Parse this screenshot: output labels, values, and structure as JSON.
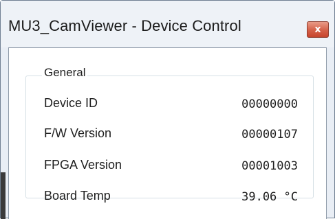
{
  "window": {
    "title": "MU3_CamViewer - Device Control",
    "close_glyph": "x"
  },
  "general": {
    "title": "General",
    "rows": [
      {
        "label": "Device ID",
        "value": "00000000"
      },
      {
        "label": "F/W Version",
        "value": "00000107"
      },
      {
        "label": "FPGA Version",
        "value": "00001003"
      },
      {
        "label": "Board Temp",
        "value": "39.06 °C"
      }
    ]
  },
  "colors": {
    "title_bar": "#eef2f7",
    "close_button": "#d46048",
    "client_background": "#ffffff"
  }
}
